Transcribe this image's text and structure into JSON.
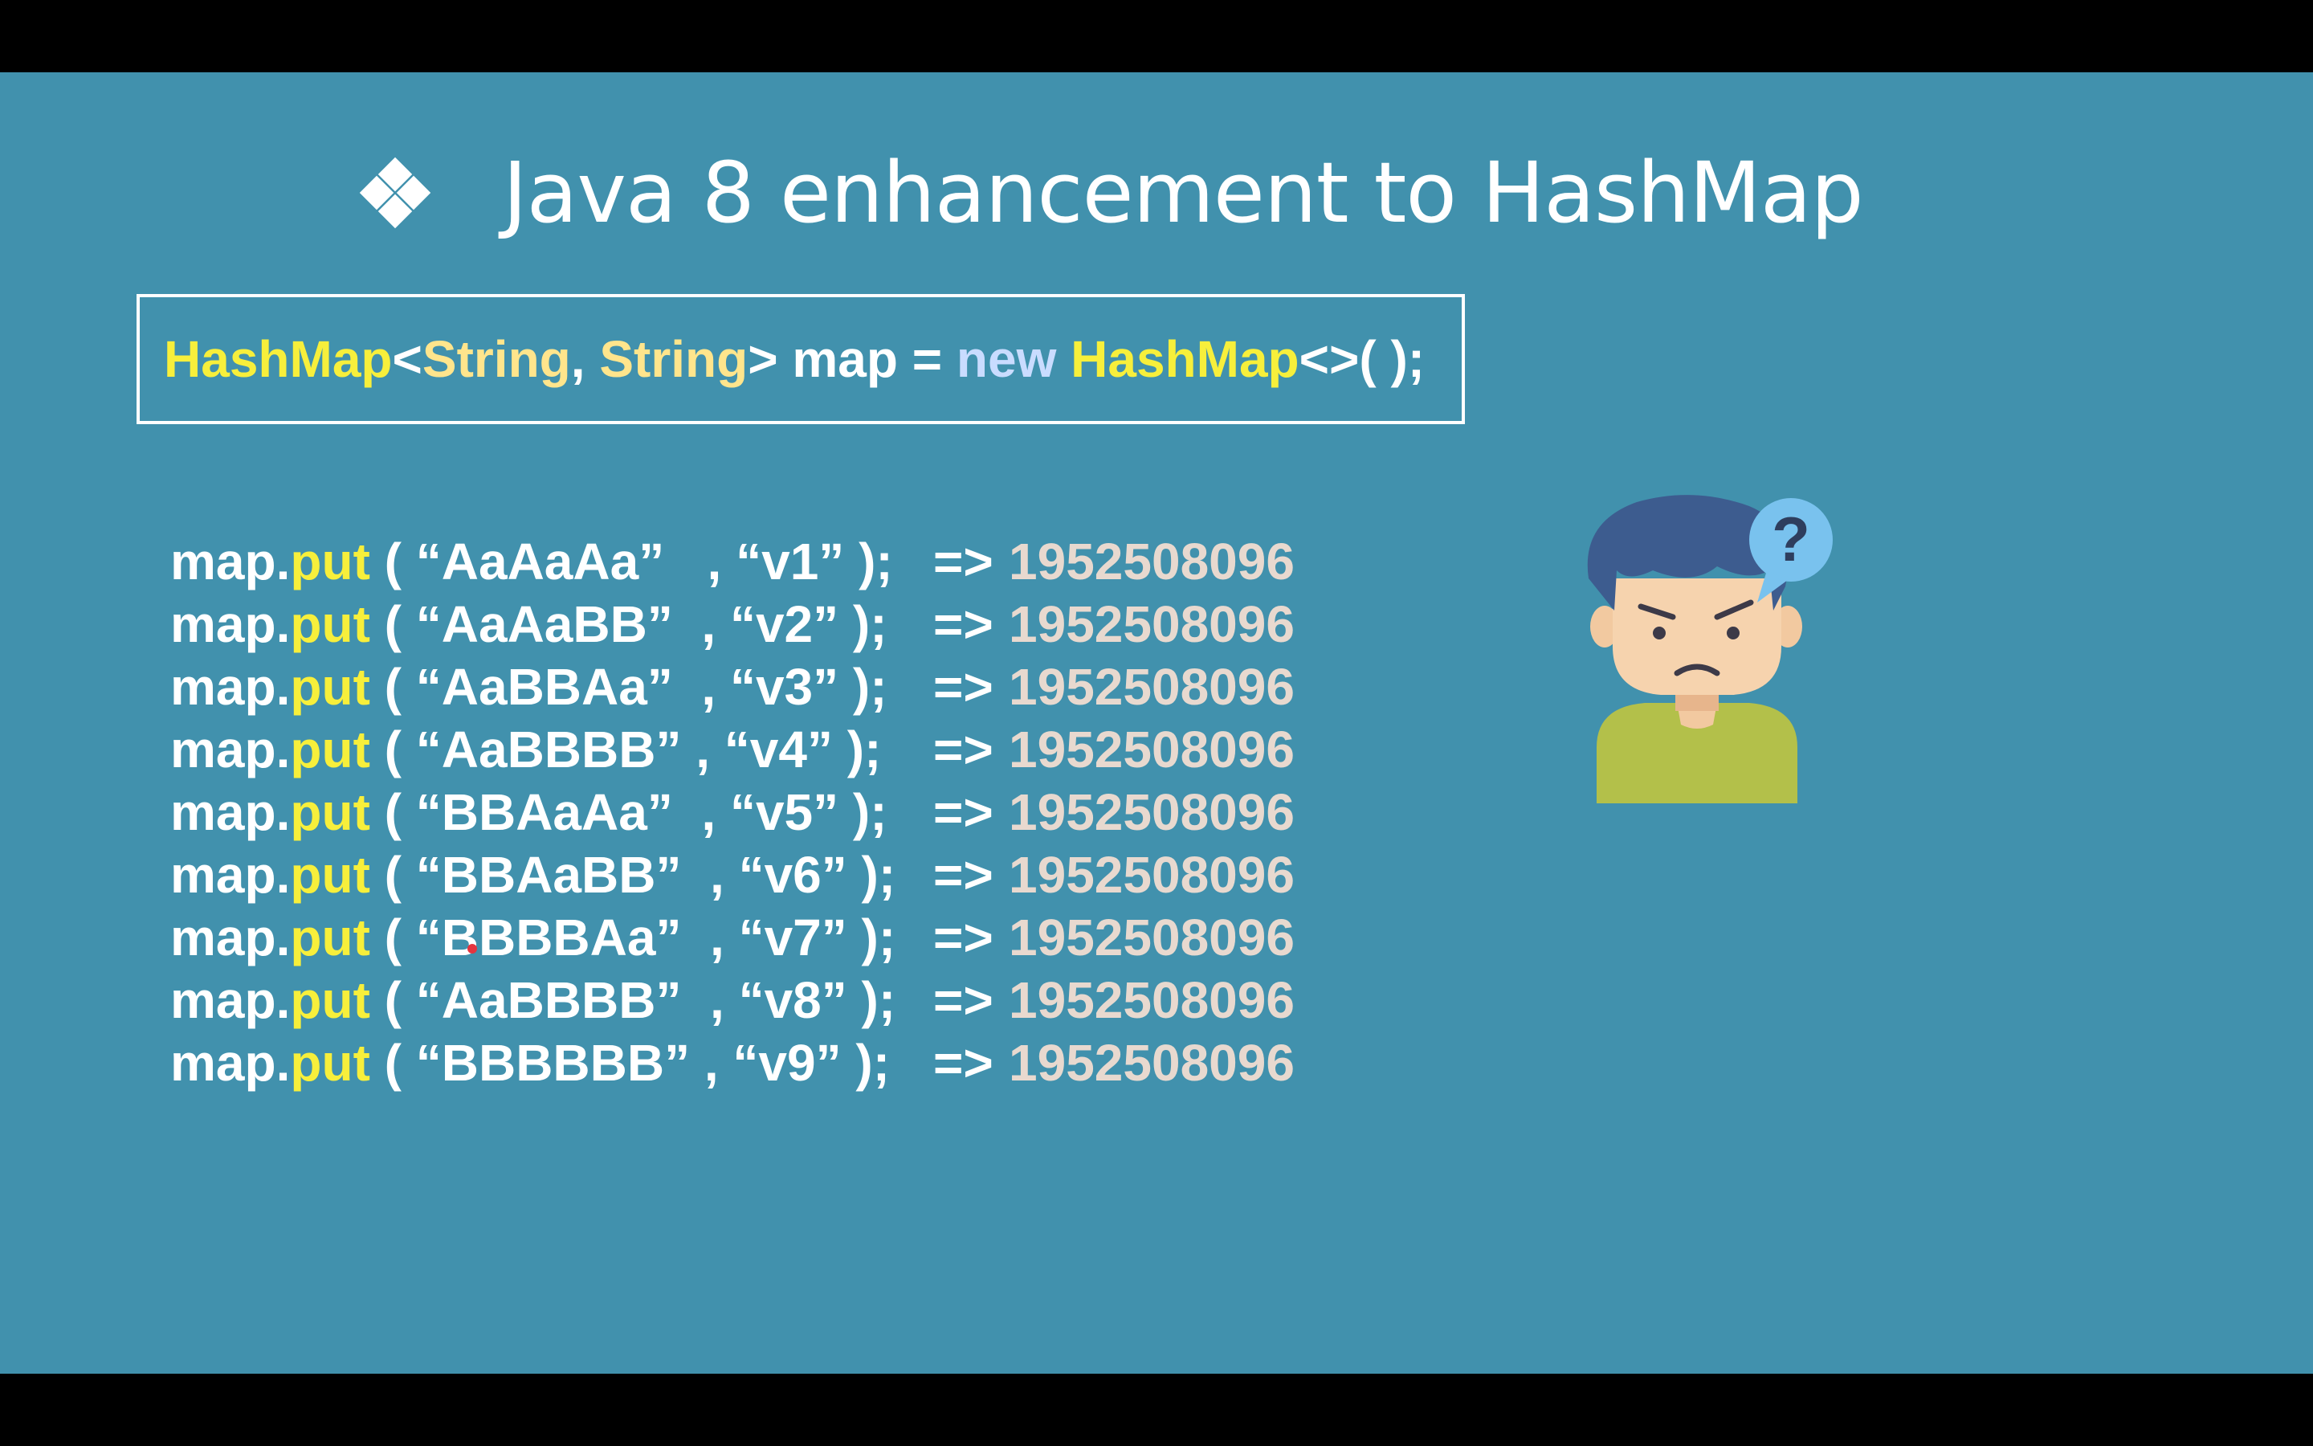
{
  "slide": {
    "title": "Java 8 enhancement to HashMap",
    "declaration": {
      "type": "HashMap",
      "open": "<",
      "arg1": "String",
      "comma": ", ",
      "arg2": "String",
      "close_var": "> map = ",
      "kw_new": "new",
      "space": " ",
      "ctor": "HashMap",
      "tail": "<>( );"
    },
    "calls": [
      {
        "prefix": "map.",
        "method": "put",
        "args": " ( “AaAaAa”   , “v1” );",
        "arrow": "=>",
        "hash": "1952508096"
      },
      {
        "prefix": "map.",
        "method": "put",
        "args": " ( “AaAaBB”  , “v2” );",
        "arrow": "=>",
        "hash": "1952508096"
      },
      {
        "prefix": "map.",
        "method": "put",
        "args": " ( “AaBBAa”  , “v3” );",
        "arrow": "=>",
        "hash": "1952508096"
      },
      {
        "prefix": "map.",
        "method": "put",
        "args": " ( “AaBBBB” , “v4” );",
        "arrow": "=>",
        "hash": "1952508096"
      },
      {
        "prefix": "map.",
        "method": "put",
        "args": " ( “BBAaAa”  , “v5” );",
        "arrow": "=>",
        "hash": "1952508096"
      },
      {
        "prefix": "map.",
        "method": "put",
        "args": " ( “BBAaBB”  , “v6” );",
        "arrow": "=>",
        "hash": "1952508096"
      },
      {
        "prefix": "map.",
        "method": "put",
        "args": " ( “BBBBAa”  , “v7” );",
        "arrow": "=>",
        "hash": "1952508096"
      },
      {
        "prefix": "map.",
        "method": "put",
        "args": " ( “AaBBBB”  , “v8” );",
        "arrow": "=>",
        "hash": "1952508096"
      },
      {
        "prefix": "map.",
        "method": "put",
        "args": " ( “BBBBBB” , “v9” );",
        "arrow": "=>",
        "hash": "1952508096"
      }
    ],
    "avatar_icon": "confused-person-icon",
    "bubble_mark": "?",
    "bullet_icon": "diamond-bullet-icon"
  },
  "colors": {
    "background": "#4191ad",
    "keyword_yellow": "#f7ef3b",
    "type_cream": "#ffe58c",
    "new_blue": "#c9dcff",
    "hash_beige": "#e8d9cf"
  }
}
